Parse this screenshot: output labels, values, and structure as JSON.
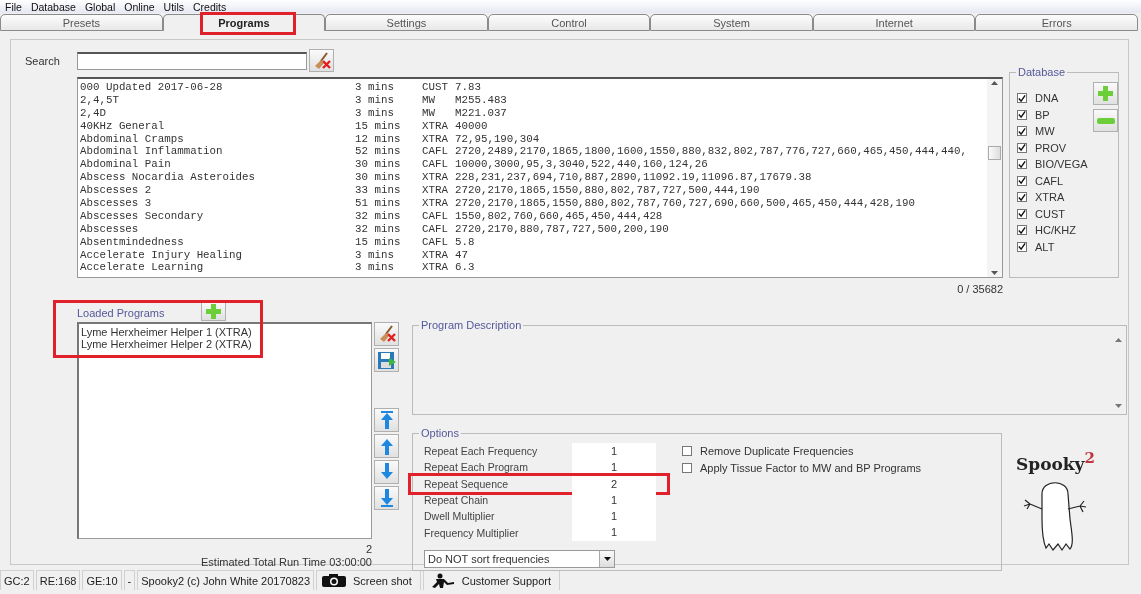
{
  "menu": [
    "File",
    "Database",
    "Global",
    "Online",
    "Utils",
    "Credits"
  ],
  "tabs": [
    {
      "label": "Presets",
      "selected": false,
      "highlighted": false
    },
    {
      "label": "Programs",
      "selected": true,
      "highlighted": true
    },
    {
      "label": "Settings",
      "selected": false,
      "highlighted": false
    },
    {
      "label": "Control",
      "selected": false,
      "highlighted": false
    },
    {
      "label": "System",
      "selected": false,
      "highlighted": false
    },
    {
      "label": "Internet",
      "selected": false,
      "highlighted": false
    },
    {
      "label": "Errors",
      "selected": false,
      "highlighted": false
    }
  ],
  "search": {
    "label": "Search"
  },
  "programs": {
    "rows": [
      {
        "name": "000 Updated 2017-06-28",
        "duration": "3 mins",
        "database": "CUST",
        "frequencies": "7.83"
      },
      {
        "name": "2,4,5T",
        "duration": "3 mins",
        "database": "MW",
        "frequencies": "M255.483"
      },
      {
        "name": "2,4D",
        "duration": "3 mins",
        "database": "MW",
        "frequencies": "M221.037"
      },
      {
        "name": "40KHz General",
        "duration": "15 mins",
        "database": "XTRA",
        "frequencies": "40000"
      },
      {
        "name": "Abdominal Cramps",
        "duration": "12 mins",
        "database": "XTRA",
        "frequencies": "72,95,190,304"
      },
      {
        "name": "Abdominal Inflammation",
        "duration": "52 mins",
        "database": "CAFL",
        "frequencies": "2720,2489,2170,1865,1800,1600,1550,880,832,802,787,776,727,660,465,450,444,440,"
      },
      {
        "name": "Abdominal Pain",
        "duration": "30 mins",
        "database": "CAFL",
        "frequencies": "10000,3000,95,3,3040,522,440,160,124,26"
      },
      {
        "name": "Abscess Nocardia Asteroides",
        "duration": "30 mins",
        "database": "XTRA",
        "frequencies": "228,231,237,694,710,887,2890,11092.19,11096.87,17679.38"
      },
      {
        "name": "Abscesses 2",
        "duration": "33 mins",
        "database": "XTRA",
        "frequencies": "2720,2170,1865,1550,880,802,787,727,500,444,190"
      },
      {
        "name": "Abscesses 3",
        "duration": "51 mins",
        "database": "XTRA",
        "frequencies": "2720,2170,1865,1550,880,802,787,760,727,690,660,500,465,450,444,428,190"
      },
      {
        "name": "Abscesses Secondary",
        "duration": "32 mins",
        "database": "CAFL",
        "frequencies": "1550,802,760,660,465,450,444,428"
      },
      {
        "name": "Abscesses",
        "duration": "32 mins",
        "database": "CAFL",
        "frequencies": "2720,2170,880,787,727,500,200,190"
      },
      {
        "name": "Absentmindedness",
        "duration": "15 mins",
        "database": "CAFL",
        "frequencies": "5.8"
      },
      {
        "name": "Accelerate Injury Healing",
        "duration": "3 mins",
        "database": "XTRA",
        "frequencies": "47"
      },
      {
        "name": "Accelerate Learning",
        "duration": "3 mins",
        "database": "XTRA",
        "frequencies": "6.3"
      }
    ],
    "count": "0 / 35682"
  },
  "database": {
    "title": "Database",
    "items": [
      {
        "label": "DNA",
        "checked": true
      },
      {
        "label": "BP",
        "checked": true
      },
      {
        "label": "MW",
        "checked": true
      },
      {
        "label": "PROV",
        "checked": true
      },
      {
        "label": "BIO/VEGA",
        "checked": true
      },
      {
        "label": "CAFL",
        "checked": true
      },
      {
        "label": "XTRA",
        "checked": true
      },
      {
        "label": "CUST",
        "checked": true
      },
      {
        "label": "HC/KHZ",
        "checked": true
      },
      {
        "label": "ALT",
        "checked": true
      }
    ]
  },
  "loaded": {
    "title": "Loaded Programs",
    "highlighted": true,
    "items": [
      "Lyme Herxheimer Helper 1 (XTRA)",
      "Lyme Herxheimer Helper 2 (XTRA)"
    ],
    "count": "2",
    "run_time": "Estimated Total Run Time 03:00:00"
  },
  "description": {
    "title": "Program Description"
  },
  "options": {
    "title": "Options",
    "rows": [
      {
        "label": "Repeat Each Frequency",
        "value": "1",
        "highlighted": false
      },
      {
        "label": "Repeat Each Program",
        "value": "1",
        "highlighted": false
      },
      {
        "label": "Repeat Sequence",
        "value": "2",
        "highlighted": true
      },
      {
        "label": "Repeat Chain",
        "value": "1",
        "highlighted": false
      },
      {
        "label": "Dwell Multiplier",
        "value": "1",
        "highlighted": false
      },
      {
        "label": "Frequency Multiplier",
        "value": "1",
        "highlighted": false
      }
    ],
    "checks": [
      {
        "label": "Remove Duplicate Frequencies",
        "checked": false
      },
      {
        "label": "Apply Tissue Factor to MW and BP Programs",
        "checked": false
      }
    ],
    "sort": "Do NOT sort frequencies"
  },
  "logo": {
    "text": "Spooky$^{2}$"
  },
  "status": {
    "segments": [
      "GC:2",
      "RE:168",
      "GE:10",
      "-",
      "Spooky2 (c) John White 20170823"
    ],
    "buttons": [
      {
        "label": "Screen shot",
        "kind": "camera"
      },
      {
        "label": "Customer Support",
        "kind": "support"
      }
    ]
  }
}
